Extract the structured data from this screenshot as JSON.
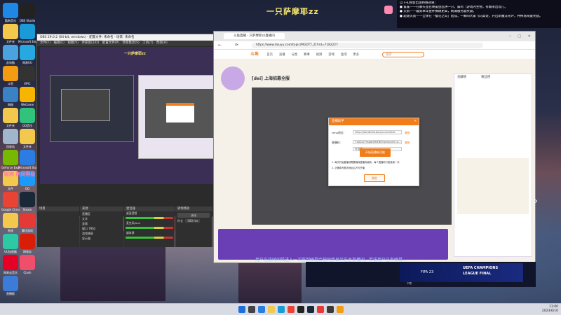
{
  "desktop": {
    "streamer_name": "一只萨摩耶zz",
    "notice_lines": [
      "以下礼物会出现特殊效果：",
      "● 鲨鲨——在聊天室召唤鲨鱼乱拱一只，属鸡（游戏内生物，有概率出现）」。",
      "● 火箭——蹦到本年金杯赛跳更高，刷满服务器奖励。",
      "● 超级火箭——全体在「樱花之岛」结成，一瞬间大家飞向高处，开启新魔法光环，并掉落海量奖励。"
    ],
    "icons": [
      {
        "label": "酷狗音乐",
        "color": "#1e88e5"
      },
      {
        "label": "文件夹",
        "color": "#f2c94c"
      },
      {
        "label": "此电脑",
        "color": "#4aa3df"
      },
      {
        "label": "斗鱼",
        "color": "#f39c12"
      },
      {
        "label": "网络",
        "color": "#3b82c4"
      },
      {
        "label": "文件夹",
        "color": "#f2c94c"
      },
      {
        "label": "回收站",
        "color": "#9fb6cc"
      },
      {
        "label": "GeForce Experience",
        "color": "#76b900"
      },
      {
        "label": "文件",
        "color": "#f2c94c"
      },
      {
        "label": "Google Chrome",
        "color": "#e94335"
      },
      {
        "label": "系统",
        "color": "#f2c94c"
      },
      {
        "label": "UU加速器",
        "color": "#2dc9a5"
      },
      {
        "label": "网易云音乐",
        "color": "#e60026"
      },
      {
        "label": "直播姬",
        "color": "#3d7bd9"
      },
      {
        "label": "OBS Studio",
        "color": "#222"
      },
      {
        "label": "Microsoft Edge",
        "color": "#1a9ad6"
      },
      {
        "label": "网易UU",
        "color": "#26a9e0"
      },
      {
        "label": "EPIC",
        "color": "#333"
      },
      {
        "label": "WeGame",
        "color": "#f7b500"
      },
      {
        "label": "QQ音乐",
        "color": "#31c27c"
      },
      {
        "label": "文件夹",
        "color": "#f2c94c"
      },
      {
        "label": "Microsoft Store",
        "color": "#2c7de1"
      },
      {
        "label": "QQ",
        "color": "#1a9bfc"
      },
      {
        "label": "Steam",
        "color": "#1b2838"
      },
      {
        "label": "腾讯游戏",
        "color": "#e53935"
      },
      {
        "label": "网易云",
        "color": "#d81e06"
      },
      {
        "label": "Clash",
        "color": "#ef4f6a"
      }
    ],
    "overlay_text": "昵称 房间等级 棒棒哒",
    "bottom_caption": "用户在该时间段进入一次签到弹幕会被同步显示在主直播间，若该用户已有弹幕…"
  },
  "obs": {
    "title": "OBS 29.0.2 (64-bit, windows) - 配置文件: 未命名 - 场景: 未命名",
    "menu": "文件(F) 编辑(E) 视图(V) 停靠窗口(D) 配置文件(P) 场景集合(S) 工具(T) 帮助(H)",
    "docks": {
      "scenes": "场景",
      "sources": "来源",
      "mixer": "混音器",
      "transitions": "转场特效",
      "controls": "控件"
    },
    "sources": [
      "直播区",
      "文字",
      "竖版",
      "窗口 7862",
      "游戏捕获",
      "显示器"
    ],
    "mixer_tracks": [
      "桌面音频",
      "麦克风/Aux",
      "媒体源"
    ],
    "transition_value": "淡化",
    "duration_label": "时长",
    "duration_value": "300 ms",
    "control_buttons": [
      "开始直播",
      "开始录制",
      "启动虚拟摄像机",
      "工作室模式",
      "设置",
      "退出"
    ]
  },
  "browser": {
    "tab_title": "斗鱼直播 - 只萨摩耶zz直播间",
    "url": "https://www.douyu.com/topic/MGDTT_Zi?rid=7182227",
    "site_logo": "斗鱼",
    "nav_items": [
      "首页",
      "直播",
      "分类",
      "赛事",
      "视频",
      "游戏",
      "鱼吧",
      "更多"
    ],
    "search_placeholder": "搜索",
    "room_title": "[dei] 上海招募全服",
    "side_tabs": [
      "贡献榜",
      "粉丝团"
    ]
  },
  "modal": {
    "title": "直播助手",
    "field1_label": "rtmp地址：",
    "field1_value": "rtmp://sendtc3a.douyu.com/live",
    "field1_button": "复制",
    "field2_label": "直播码：",
    "field2_value": "7182227rKq8d9NFBR?wsSecret=a...",
    "field2_button": "复制",
    "field3_label": "",
    "field3_value": "可选项",
    "orange_button": "开始直播新功能",
    "tips": [
      "1. 每次开始直播前需要确保直播码最新，每个直播码只能使用一次",
      "2. 正确填写推流地址后方可开播"
    ],
    "confirm_button": "确定"
  },
  "small_window": {
    "banner_title": "UEFA CHAMPIONS",
    "banner_sub": "LEAGUE FINAL",
    "game": "FIFA 23",
    "status": "下载"
  },
  "taskbar": {
    "time": "11:00",
    "date": "2023/6/10"
  }
}
